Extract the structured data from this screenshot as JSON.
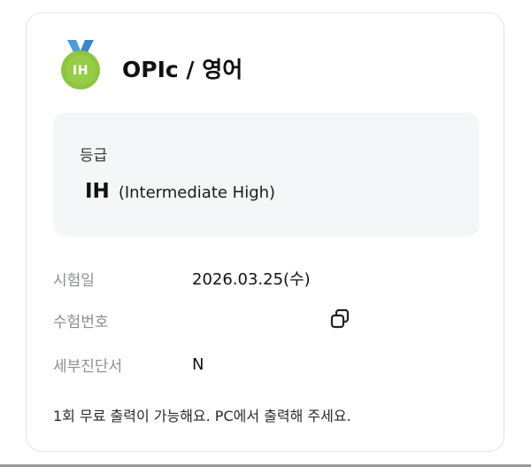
{
  "header": {
    "medal_text": "IH",
    "title": "OPIc / 영어"
  },
  "grade": {
    "label": "등급",
    "code": "IH",
    "full_name": "(Intermediate High)"
  },
  "info": {
    "exam_date_label": "시험일",
    "exam_date_value": "2026.03.25(수)",
    "exam_number_label": "수험번호",
    "exam_number_value": "",
    "detail_report_label": "세부진단서",
    "detail_report_value": "N"
  },
  "notice": "1회 무료 출력이 가능해요. PC에서 출력해 주세요.",
  "icons": {
    "medal": "medal-icon",
    "copy": "copy-icon"
  },
  "colors": {
    "medal_green": "#8cc63f",
    "ribbon_blue": "#4f9bd9",
    "grade_box_bg": "#f4f6f8",
    "label_gray": "#8a8e94"
  }
}
